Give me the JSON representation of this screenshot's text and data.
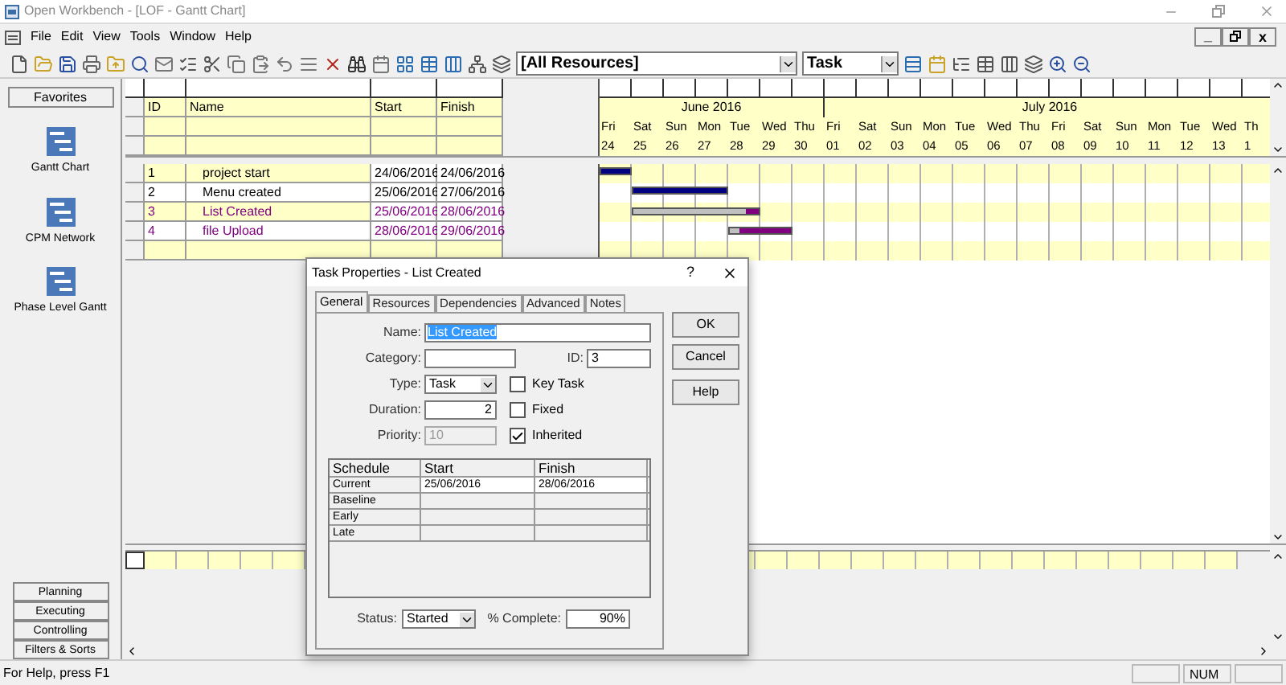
{
  "window": {
    "title": "Open Workbench - [LOF - Gantt Chart]"
  },
  "menu": [
    "File",
    "Edit",
    "View",
    "Tools",
    "Window",
    "Help"
  ],
  "mdi_controls": {
    "minimize": "_",
    "close": "x"
  },
  "toolbar": {
    "resource_filter": "[All Resources]",
    "view_type": "Task"
  },
  "sidebar": {
    "header": "Favorites",
    "items": [
      "Gantt Chart",
      "CPM Network",
      "Phase Level Gantt"
    ],
    "groups": [
      "Planning",
      "Executing",
      "Controlling",
      "Filters & Sorts"
    ]
  },
  "table": {
    "columns": [
      "ID",
      "Name",
      "Start",
      "Finish"
    ],
    "rows": [
      {
        "id": "1",
        "name": "project start",
        "start": "24/06/2016",
        "finish": "24/06/2016",
        "critical": false
      },
      {
        "id": "2",
        "name": "Menu created",
        "start": "25/06/2016",
        "finish": "27/06/2016",
        "critical": false
      },
      {
        "id": "3",
        "name": "List Created",
        "start": "25/06/2016",
        "finish": "28/06/2016",
        "critical": true,
        "level": 0.9
      },
      {
        "id": "4",
        "name": "file Upload",
        "start": "28/06/2016",
        "finish": "29/06/2016",
        "critical": true,
        "level": 0.15
      }
    ]
  },
  "timeline": {
    "months": [
      {
        "label": "June 2016",
        "days": [
          {
            "weekday": "Fri",
            "day": "24"
          },
          {
            "weekday": "Sat",
            "day": "25"
          },
          {
            "weekday": "Sun",
            "day": "26"
          },
          {
            "weekday": "Mon",
            "day": "27"
          },
          {
            "weekday": "Tue",
            "day": "28"
          },
          {
            "weekday": "Wed",
            "day": "29"
          },
          {
            "weekday": "Thu",
            "day": "30"
          }
        ]
      },
      {
        "label": "July 2016",
        "days": [
          {
            "weekday": "Fri",
            "day": "01"
          },
          {
            "weekday": "Sat",
            "day": "02"
          },
          {
            "weekday": "Sun",
            "day": "03"
          },
          {
            "weekday": "Mon",
            "day": "04"
          },
          {
            "weekday": "Tue",
            "day": "05"
          },
          {
            "weekday": "Wed",
            "day": "06"
          },
          {
            "weekday": "Thu",
            "day": "07"
          },
          {
            "weekday": "Fri",
            "day": "08"
          },
          {
            "weekday": "Sat",
            "day": "09"
          },
          {
            "weekday": "Sun",
            "day": "10"
          },
          {
            "weekday": "Mon",
            "day": "11"
          },
          {
            "weekday": "Tue",
            "day": "12"
          },
          {
            "weekday": "Wed",
            "day": "13"
          },
          {
            "weekday": "Th",
            "day": "1"
          }
        ]
      }
    ]
  },
  "dialog": {
    "title": "Task Properties - List Created",
    "help": "?",
    "tabs": [
      {
        "label": "General",
        "selected": true
      },
      {
        "label": "Resources",
        "selected": false
      },
      {
        "label": "Dependencies",
        "selected": false
      },
      {
        "label": "Advanced",
        "selected": false
      },
      {
        "label": "Notes",
        "selected": false
      }
    ],
    "name": {
      "label": "Name:",
      "value": "List Created"
    },
    "category": {
      "label": "Category:"
    },
    "id": {
      "label": "ID:",
      "value": "3"
    },
    "type": {
      "label": "Type:",
      "value": "Task"
    },
    "key_task": {
      "label": "Key Task",
      "checked": false
    },
    "duration": {
      "label": "Duration:",
      "value": "2"
    },
    "fixed": {
      "label": "Fixed",
      "checked": false
    },
    "priority": {
      "label": "Priority:",
      "value": "10",
      "disabled": true
    },
    "inherited": {
      "label": "Inherited",
      "checked": true
    },
    "schedule": {
      "columns": [
        "Schedule",
        "Start",
        "Finish"
      ],
      "rows": [
        [
          "Current",
          "25/06/2016",
          "28/06/2016"
        ],
        [
          "Baseline",
          "",
          ""
        ],
        [
          "Early",
          "",
          ""
        ],
        [
          "Late",
          "",
          ""
        ]
      ]
    },
    "status": {
      "label": "Status:",
      "value": "Started"
    },
    "complete": {
      "label": "% Complete:",
      "value": "90%"
    },
    "buttons": [
      "OK",
      "Cancel",
      "Help"
    ]
  },
  "status_bar": {
    "text": "For Help, press F1",
    "indicators": [
      "NUM"
    ]
  }
}
